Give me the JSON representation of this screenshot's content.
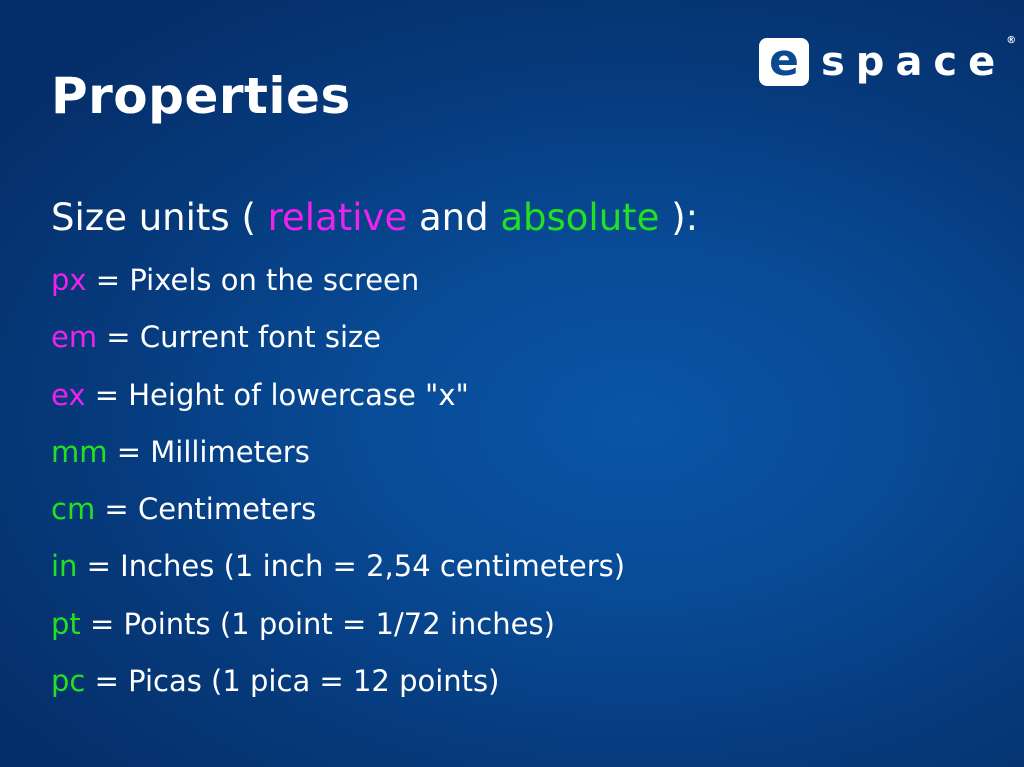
{
  "slide": {
    "title": "Properties"
  },
  "logo": {
    "letter": "e",
    "text": "space",
    "registered": "®"
  },
  "heading": {
    "prefix": "Size units ( ",
    "relative": "relative",
    "middle": " and ",
    "absolute": "absolute",
    "suffix": " ):"
  },
  "units": [
    {
      "code": "px",
      "desc": " = Pixels on the screen",
      "kind": "relative"
    },
    {
      "code": "em",
      "desc": " = Current font size",
      "kind": "relative"
    },
    {
      "code": "ex",
      "desc": " = Height of lowercase \"x\"",
      "kind": "relative"
    },
    {
      "code": "mm",
      "desc": " = Millimeters",
      "kind": "absolute"
    },
    {
      "code": "cm",
      "desc": " = Centimeters",
      "kind": "absolute"
    },
    {
      "code": "in",
      "desc": " = Inches (1 inch = 2,54 centimeters)",
      "kind": "absolute"
    },
    {
      "code": "pt",
      "desc": " = Points (1 point = 1/72 inches)",
      "kind": "absolute"
    },
    {
      "code": "pc",
      "desc": " = Picas (1 pica = 12 points)",
      "kind": "absolute"
    }
  ],
  "colors": {
    "relative": "#ee22ee",
    "absolute": "#22e022",
    "background": "#084b96",
    "text": "#ffffff"
  }
}
